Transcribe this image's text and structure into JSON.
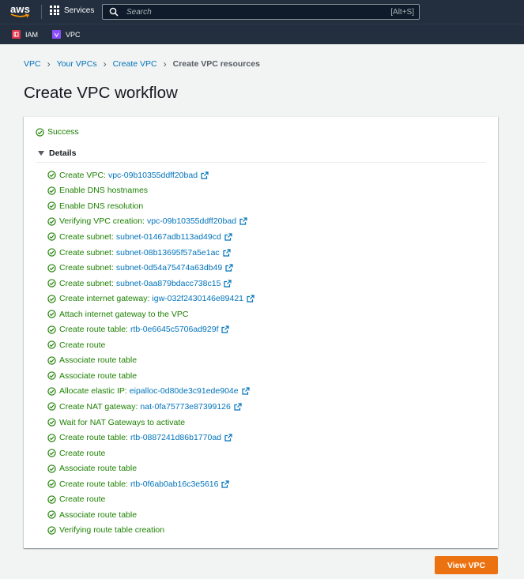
{
  "nav": {
    "logo": "aws",
    "services_label": "Services",
    "search_placeholder": "Search",
    "search_shortcut": "[Alt+S]"
  },
  "favorites": [
    {
      "label": "IAM",
      "icon": "iam-icon",
      "color": "#dd344c"
    },
    {
      "label": "VPC",
      "icon": "vpc-icon",
      "color": "#8c4fff"
    }
  ],
  "breadcrumb": {
    "items": [
      "VPC",
      "Your VPCs",
      "Create VPC"
    ],
    "current": "Create VPC resources"
  },
  "page_title": "Create VPC workflow",
  "status": "Success",
  "details_label": "Details",
  "steps": [
    {
      "text": "Create VPC:",
      "link": "vpc-09b10355ddff20bad"
    },
    {
      "text": "Enable DNS hostnames"
    },
    {
      "text": "Enable DNS resolution"
    },
    {
      "text": "Verifying VPC creation:",
      "link": "vpc-09b10355ddff20bad"
    },
    {
      "text": "Create subnet:",
      "link": "subnet-01467adb113ad49cd"
    },
    {
      "text": "Create subnet:",
      "link": "subnet-08b13695f57a5e1ac"
    },
    {
      "text": "Create subnet:",
      "link": "subnet-0d54a75474a63db49"
    },
    {
      "text": "Create subnet:",
      "link": "subnet-0aa879bdacc738c15"
    },
    {
      "text": "Create internet gateway:",
      "link": "igw-032f2430146e89421"
    },
    {
      "text": "Attach internet gateway to the VPC"
    },
    {
      "text": "Create route table:",
      "link": "rtb-0e6645c5706ad929f"
    },
    {
      "text": "Create route"
    },
    {
      "text": "Associate route table"
    },
    {
      "text": "Associate route table"
    },
    {
      "text": "Allocate elastic IP:",
      "link": "eipalloc-0d80de3c91ede904e"
    },
    {
      "text": "Create NAT gateway:",
      "link": "nat-0fa75773e87399126"
    },
    {
      "text": "Wait for NAT Gateways to activate"
    },
    {
      "text": "Create route table:",
      "link": "rtb-0887241d86b1770ad"
    },
    {
      "text": "Create route"
    },
    {
      "text": "Associate route table"
    },
    {
      "text": "Create route table:",
      "link": "rtb-0f6ab0ab16c3e5616"
    },
    {
      "text": "Create route"
    },
    {
      "text": "Associate route table"
    },
    {
      "text": "Verifying route table creation"
    }
  ],
  "view_button": "View VPC",
  "colors": {
    "success": "#1d8102",
    "link": "#0073bb",
    "primary_button": "#ec7211",
    "nav_bg": "#232f3e"
  }
}
